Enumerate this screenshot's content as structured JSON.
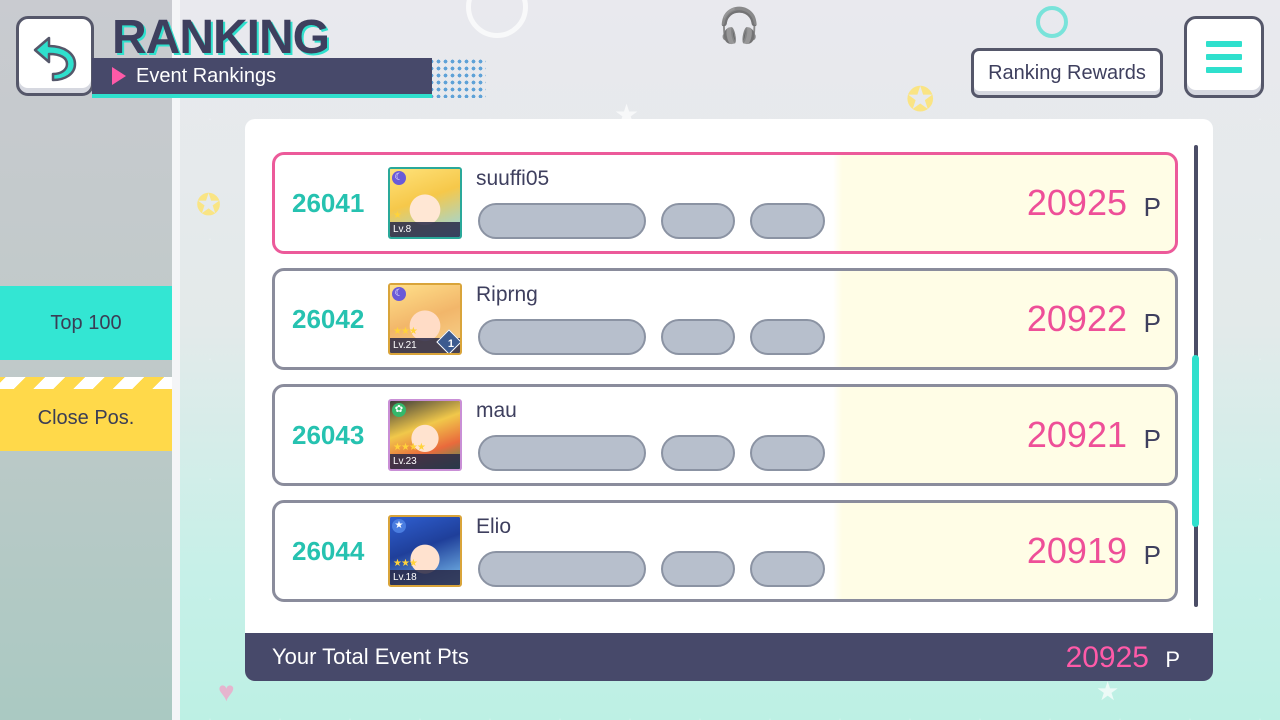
{
  "header": {
    "title": "RANKING",
    "subtitle": "Event Rankings",
    "rewards_label": "Ranking Rewards"
  },
  "side_tabs": [
    {
      "label": "Top 100",
      "color": "#33e6d3"
    },
    {
      "label": "Close Pos.",
      "color": "#ffd94a"
    }
  ],
  "rows": [
    {
      "rank": "26041",
      "name": "suuffi05",
      "points": "20925",
      "unit": "P",
      "level": "Lv.8",
      "stars": "★",
      "highlight": true
    },
    {
      "rank": "26042",
      "name": "Riprng",
      "points": "20922",
      "unit": "P",
      "level": "Lv.21",
      "stars": "★★★",
      "badge": "1"
    },
    {
      "rank": "26043",
      "name": "mau",
      "points": "20921",
      "unit": "P",
      "level": "Lv.23",
      "stars": "★★★★"
    },
    {
      "rank": "26044",
      "name": "Elio",
      "points": "20919",
      "unit": "P",
      "level": "Lv.18",
      "stars": "★★★"
    }
  ],
  "total": {
    "label": "Your Total Event Pts",
    "value": "20925",
    "unit": "P"
  },
  "colors": {
    "accent": "#2fe0cd",
    "points": "#ee4f98",
    "dark": "#47496a"
  }
}
